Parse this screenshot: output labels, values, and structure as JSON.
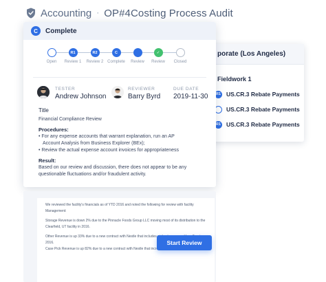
{
  "header": {
    "module": "Accounting",
    "separator": "·",
    "title": "OP#4Costing Process Audit"
  },
  "status_card": {
    "badge": "C",
    "title": "Complete"
  },
  "workflow": {
    "steps": [
      {
        "label": "Open",
        "badge": "",
        "state": "hollow"
      },
      {
        "label": "Review 1",
        "badge": "R1",
        "state": "blue"
      },
      {
        "label": "Review 2",
        "badge": "R2",
        "state": "blue"
      },
      {
        "label": "Complete",
        "badge": "C",
        "state": "blue"
      },
      {
        "label": "Review",
        "badge": "",
        "state": "blue"
      },
      {
        "label": "Review",
        "badge": "✓",
        "state": "green"
      },
      {
        "label": "Closed",
        "badge": "",
        "state": "grey"
      }
    ]
  },
  "people": {
    "tester_role": "TESTER",
    "tester_name": "Andrew Johnson",
    "reviewer_role": "REVIEWER",
    "reviewer_name": "Barry Byrd",
    "due_role": "DUE DATE",
    "due_value": "2019-11-30"
  },
  "details": {
    "title_label": "Title",
    "title_value": "Financial Compliance Review",
    "procedures_label": "Procedures:",
    "procedures": [
      "For any expense accounts that warrant explanation, run an AP",
      "Account Analysis from Business Explorer (BEx);",
      "Review the actual expense account invoices for appropriateness"
    ],
    "result_label": "Result:",
    "result_lines": [
      "Based on our review and discussion, there does not appear to be any",
      "questionable fluctuations and/or fraudulent activity."
    ]
  },
  "side_card": {
    "header": "porate (Los Angeles)",
    "subheader": "Fieldwork 1",
    "items": [
      {
        "badge": "R1",
        "label": "US.CR.3 Rebate Payments",
        "style": "filled"
      },
      {
        "badge": "",
        "label": "US.CR.3 Rebate Payments",
        "style": "outline"
      },
      {
        "badge": "R1",
        "label": "US.CR.3 Rebate Payments",
        "style": "filled"
      }
    ]
  },
  "document": {
    "paragraphs": [
      "We reviewed the facility's financials as of YTD 2016 and noted the following for review with facility Management:",
      "Storage Revenue is down 2% due to the Pinnacle Foods Group LLC moving most of its distribution to the Clearfield, UT facility in 2016.",
      "Other Revenue is up 33% due to a new contract with Nestle that includes pick, storage, and handling in 2016.",
      "Case Pick Revenue is up 82% due to a new contract with Nestle that increased rates for"
    ]
  },
  "actions": {
    "start_review": "Start Review"
  },
  "colors": {
    "accent": "#2f6fe4",
    "success": "#42c16f"
  }
}
